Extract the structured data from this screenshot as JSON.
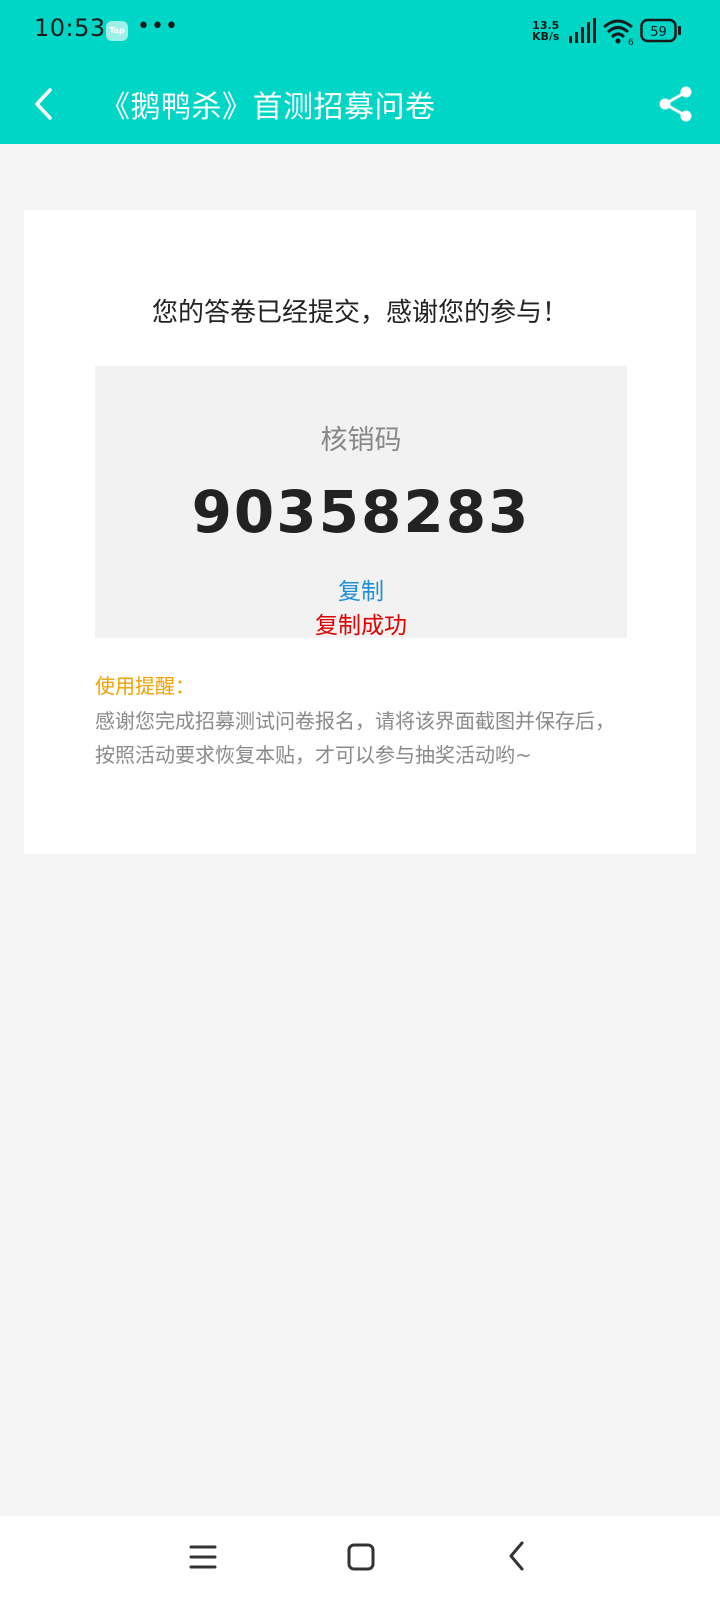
{
  "status_bar": {
    "time": "10:53",
    "app_badge": "Tap",
    "more": "•••",
    "net_speed_value": "13.5",
    "net_speed_unit": "KB/s",
    "wifi_label": "6",
    "battery": "59"
  },
  "header": {
    "title": "《鹅鸭杀》首测招募问卷",
    "color": "#00d6c5"
  },
  "card": {
    "message": "您的答卷已经提交，感谢您的参与！",
    "code_label": "核销码",
    "code_value": "90358283",
    "copy_label": "复制",
    "copy_status": "复制成功",
    "reminder_title": "使用提醒：",
    "reminder_text": "感谢您完成招募测试问卷报名，请将该界面截图并保存后，按照活动要求恢复本贴，才可以参与抽奖活动哟~"
  },
  "icons": {
    "back": "back-arrow-icon",
    "share": "share-icon",
    "nav_menu": "menu-icon",
    "nav_home": "home-icon",
    "nav_back": "back-icon"
  }
}
